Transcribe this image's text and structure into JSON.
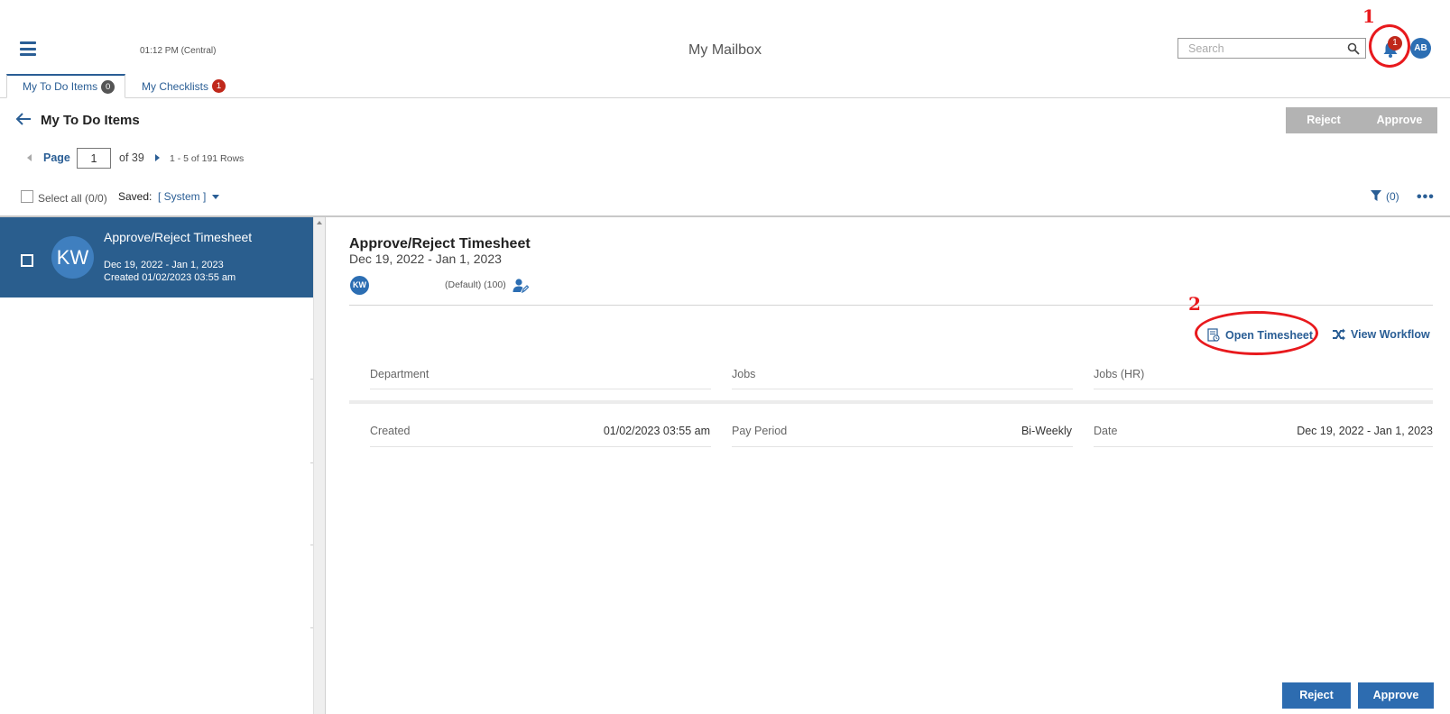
{
  "header": {
    "time": "01:12 PM (Central)",
    "title": "My Mailbox",
    "search_placeholder": "Search",
    "notification_count": "1",
    "user_initials": "AB"
  },
  "annotations": [
    "1",
    "2"
  ],
  "tabs": [
    {
      "label": "My To Do Items",
      "badge": "0"
    },
    {
      "label": "My Checklists",
      "badge": "1"
    }
  ],
  "toolbar": {
    "title": "My To Do Items",
    "reject_label": "Reject",
    "approve_label": "Approve",
    "page_label": "Page",
    "page_value": "1",
    "of_text": "of 39",
    "rows_text": "1 - 5 of 191 Rows",
    "select_all": "Select all (0/0)",
    "saved_label": "Saved:",
    "saved_value": "[ System ]",
    "filter_count": "(0)",
    "more": "•••"
  },
  "list": [
    {
      "initials": "KW",
      "title": "Approve/Reject Timesheet",
      "dates": "Dec 19, 2022 - Jan 1, 2023",
      "created": "Created 01/02/2023 03:55 am"
    }
  ],
  "detail": {
    "title": "Approve/Reject Timesheet",
    "range": "Dec 19, 2022 - Jan 1, 2023",
    "initials": "KW",
    "default_text": "(Default) (100)",
    "open_timesheet": "Open Timesheet",
    "view_workflow": "View Workflow",
    "fields_row1": [
      {
        "label": "Department",
        "value": ""
      },
      {
        "label": "Jobs",
        "value": ""
      },
      {
        "label": "Jobs (HR)",
        "value": ""
      }
    ],
    "fields_row2": [
      {
        "label": "Created",
        "value": "01/02/2023 03:55 am"
      },
      {
        "label": "Pay Period",
        "value": "Bi-Weekly"
      },
      {
        "label": "Date",
        "value": "Dec 19, 2022 - Jan 1, 2023"
      }
    ],
    "reject_label": "Reject",
    "approve_label": "Approve"
  },
  "colors": {
    "brand": "#2a5e95",
    "selected_row": "#2a5e8e",
    "badge_red": "#c0281b",
    "annotation_red": "#e8191d",
    "button_blue": "#2d6cb0",
    "button_disabled": "#b3b3b3"
  },
  "icons": [
    "hamburger-icon",
    "search-icon",
    "bell-icon",
    "back-arrow-icon",
    "filter-icon",
    "person-edit-icon",
    "timesheet-icon",
    "workflow-icon"
  ]
}
